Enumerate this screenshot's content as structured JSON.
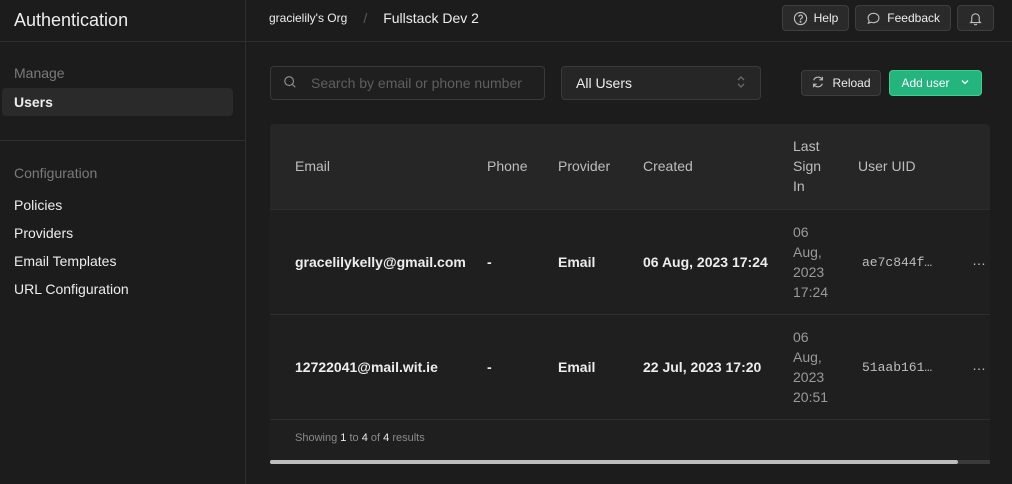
{
  "sidebar": {
    "title": "Authentication",
    "manage_label": "Manage",
    "manage_items": [
      {
        "label": "Users"
      }
    ],
    "config_label": "Configuration",
    "config_items": [
      {
        "label": "Policies"
      },
      {
        "label": "Providers"
      },
      {
        "label": "Email Templates"
      },
      {
        "label": "URL Configuration"
      }
    ]
  },
  "breadcrumb": {
    "org": "gracielily's Org",
    "separator": "/",
    "project": "Fullstack Dev 2"
  },
  "top_actions": {
    "help": "Help",
    "feedback": "Feedback"
  },
  "toolbar": {
    "search_placeholder": "Search by email or phone number",
    "filter_value": "All Users",
    "reload": "Reload",
    "add_user": "Add user"
  },
  "table": {
    "columns": [
      "Email",
      "Phone",
      "Provider",
      "Created",
      "Last\nSign\nIn",
      "User UID"
    ],
    "rows": [
      {
        "email": "gracelilykelly@gmail.com",
        "phone": "-",
        "provider": "Email",
        "created": "06 Aug, 2023 17:24",
        "last_sign_in": "06\nAug,\n2023\n17:24",
        "uid": "ae7c844f…",
        "menu": "…"
      },
      {
        "email": "12722041@mail.wit.ie",
        "phone": "-",
        "provider": "Email",
        "created": "22 Jul, 2023 17:20",
        "last_sign_in": "06\nAug,\n2023\n20:51",
        "uid": "51aab161…",
        "menu": "…"
      }
    ],
    "footer": {
      "prefix": "Showing",
      "from": "1",
      "to_word": "to",
      "to": "4",
      "of_word": "of",
      "total": "4",
      "suffix": "results"
    }
  },
  "colors": {
    "accent": "#24b47e",
    "background": "#1c1c1c"
  },
  "icons": [
    "help-icon",
    "feedback-icon",
    "bell-icon",
    "search-icon",
    "updown-icon",
    "reload-icon",
    "chevron-down-icon"
  ]
}
